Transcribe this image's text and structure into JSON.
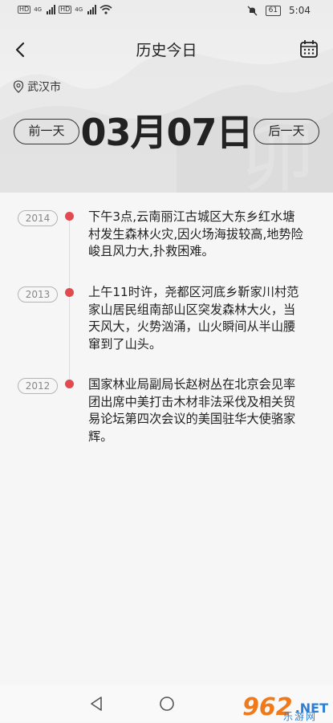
{
  "status_bar": {
    "left": {
      "hd": "HD",
      "network": "4G"
    },
    "battery": "61",
    "time": "5:04"
  },
  "header": {
    "title": "历史今日",
    "location": "武汉市",
    "date": "03月07日",
    "prev_button": "前一天",
    "next_button": "后一天"
  },
  "events": [
    {
      "year": "2014",
      "text": "下午3点,云南丽江古城区大东乡红水塘村发生森林火灾,因火场海拔较高,地势险峻且风力大,扑救困难。"
    },
    {
      "year": "2013",
      "text": "上午11时许，尧都区河底乡靳家川村范家山居民组南部山区突发森林大火，当天风大，火势汹涌，山火瞬间从半山腰窜到了山头。"
    },
    {
      "year": "2012",
      "text": "国家林业局副局长赵树丛在北京会见率团出席中美打击木材非法采伐及相关贸易论坛第四次会议的美国驻华大使骆家辉。"
    }
  ],
  "watermark": {
    "logo": "962",
    "net": ".NET",
    "sub": "乐游网"
  }
}
